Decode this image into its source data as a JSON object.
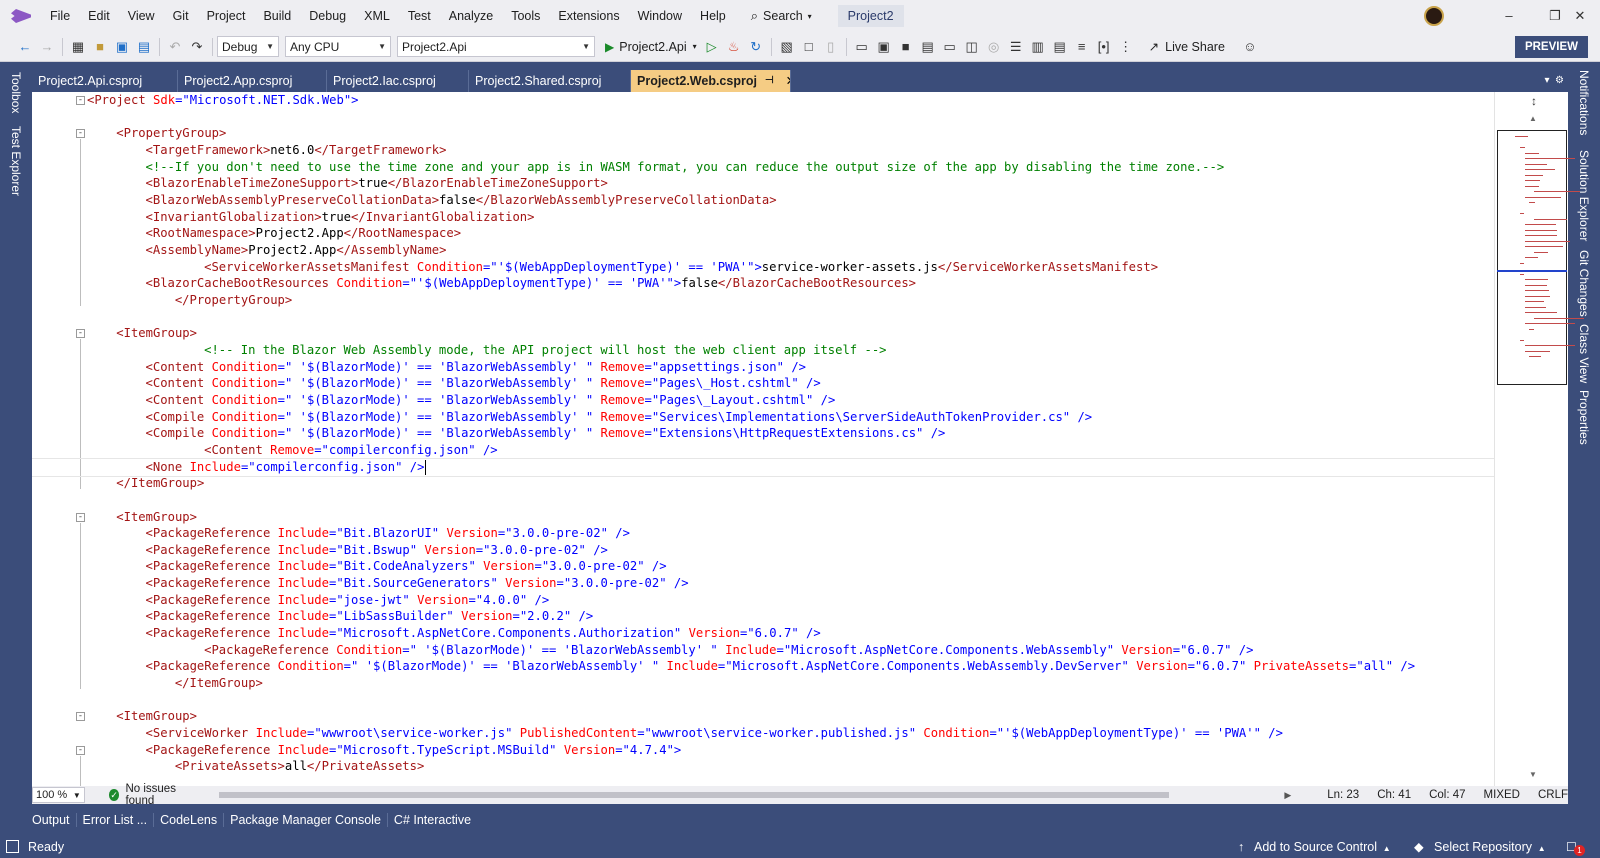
{
  "menu": {
    "items": [
      "File",
      "Edit",
      "View",
      "Git",
      "Project",
      "Build",
      "Debug",
      "XML",
      "Test",
      "Analyze",
      "Tools",
      "Extensions",
      "Window",
      "Help"
    ],
    "search_label": "Search",
    "solution_name": "Project2"
  },
  "toolbar": {
    "configuration": "Debug",
    "platform": "Any CPU",
    "startup_project": "Project2.Api",
    "run_label": "Project2.Api",
    "live_share_label": "Live Share",
    "preview_label": "PREVIEW"
  },
  "left_rail": {
    "tabs": [
      "Toolbox",
      "Test Explorer"
    ]
  },
  "right_rail": {
    "tabs": [
      "Notifications",
      "Solution Explorer",
      "Git Changes",
      "Class View",
      "Properties"
    ]
  },
  "tabs": [
    {
      "label": "Project2.Api.csproj",
      "active": false
    },
    {
      "label": "Project2.App.csproj",
      "active": false
    },
    {
      "label": "Project2.Iac.csproj",
      "active": false
    },
    {
      "label": "Project2.Shared.csproj",
      "active": false
    },
    {
      "label": "Project2.Web.csproj",
      "active": true
    }
  ],
  "editor": {
    "lines": [
      {
        "indent": 0,
        "fold": true,
        "tokens": [
          [
            "t",
            "<Project "
          ],
          [
            "a",
            "Sdk"
          ],
          [
            "p",
            "=\""
          ],
          [
            "v",
            "Microsoft.NET.Sdk.Web"
          ],
          [
            "p",
            "\">"
          ]
        ]
      },
      {
        "indent": 0,
        "tokens": []
      },
      {
        "indent": 4,
        "fold": true,
        "tokens": [
          [
            "t",
            "<PropertyGroup>"
          ]
        ]
      },
      {
        "indent": 8,
        "tokens": [
          [
            "t",
            "<TargetFramework>"
          ],
          [
            "x",
            "net6.0"
          ],
          [
            "t",
            "</TargetFramework>"
          ]
        ]
      },
      {
        "indent": 8,
        "tokens": [
          [
            "c",
            "<!--If you don't need to use the time zone and your app is in WASM format, you can reduce the output size of the app by disabling the time zone.-->"
          ]
        ]
      },
      {
        "indent": 8,
        "tokens": [
          [
            "t",
            "<BlazorEnableTimeZoneSupport>"
          ],
          [
            "x",
            "true"
          ],
          [
            "t",
            "</BlazorEnableTimeZoneSupport>"
          ]
        ]
      },
      {
        "indent": 8,
        "tokens": [
          [
            "t",
            "<BlazorWebAssemblyPreserveCollationData>"
          ],
          [
            "x",
            "false"
          ],
          [
            "t",
            "</BlazorWebAssemblyPreserveCollationData>"
          ]
        ]
      },
      {
        "indent": 8,
        "tokens": [
          [
            "t",
            "<InvariantGlobalization>"
          ],
          [
            "x",
            "true"
          ],
          [
            "t",
            "</InvariantGlobalization>"
          ]
        ]
      },
      {
        "indent": 8,
        "tokens": [
          [
            "t",
            "<RootNamespace>"
          ],
          [
            "x",
            "Project2.App"
          ],
          [
            "t",
            "</RootNamespace>"
          ]
        ]
      },
      {
        "indent": 8,
        "tokens": [
          [
            "t",
            "<AssemblyName>"
          ],
          [
            "x",
            "Project2.App"
          ],
          [
            "t",
            "</AssemblyName>"
          ]
        ]
      },
      {
        "indent": 16,
        "tokens": [
          [
            "t",
            "<ServiceWorkerAssetsManifest "
          ],
          [
            "a",
            "Condition"
          ],
          [
            "p",
            "=\"'"
          ],
          [
            "v",
            "$(WebAppDeploymentType)' == 'PWA'"
          ],
          [
            "p",
            "\">"
          ],
          [
            "x",
            "service-worker-assets.js"
          ],
          [
            "t",
            "</ServiceWorkerAssetsManifest>"
          ]
        ]
      },
      {
        "indent": 8,
        "tokens": [
          [
            "t",
            "<BlazorCacheBootResources "
          ],
          [
            "a",
            "Condition"
          ],
          [
            "p",
            "=\"'"
          ],
          [
            "v",
            "$(WebAppDeploymentType)' == 'PWA'"
          ],
          [
            "p",
            "\">"
          ],
          [
            "x",
            "false"
          ],
          [
            "t",
            "</BlazorCacheBootResources>"
          ]
        ]
      },
      {
        "indent": 12,
        "tokens": [
          [
            "t",
            "</PropertyGroup>"
          ]
        ]
      },
      {
        "indent": 0,
        "tokens": []
      },
      {
        "indent": 4,
        "fold": true,
        "tokens": [
          [
            "t",
            "<ItemGroup>"
          ]
        ]
      },
      {
        "indent": 16,
        "tokens": [
          [
            "c",
            "<!-- In the Blazor Web Assembly mode, the API project will host the web client app itself -->"
          ]
        ]
      },
      {
        "indent": 8,
        "tokens": [
          [
            "t",
            "<Content "
          ],
          [
            "a",
            "Condition"
          ],
          [
            "p",
            "=\" "
          ],
          [
            "v",
            "'$(BlazorMode)' == 'BlazorWebAssembly' "
          ],
          [
            "p",
            "\" "
          ],
          [
            "a",
            "Remove"
          ],
          [
            "p",
            "=\""
          ],
          [
            "v",
            "appsettings.json"
          ],
          [
            "p",
            "\" />"
          ]
        ]
      },
      {
        "indent": 8,
        "tokens": [
          [
            "t",
            "<Content "
          ],
          [
            "a",
            "Condition"
          ],
          [
            "p",
            "=\" "
          ],
          [
            "v",
            "'$(BlazorMode)' == 'BlazorWebAssembly' "
          ],
          [
            "p",
            "\" "
          ],
          [
            "a",
            "Remove"
          ],
          [
            "p",
            "=\""
          ],
          [
            "v",
            "Pages\\_Host.cshtml"
          ],
          [
            "p",
            "\" />"
          ]
        ]
      },
      {
        "indent": 8,
        "tokens": [
          [
            "t",
            "<Content "
          ],
          [
            "a",
            "Condition"
          ],
          [
            "p",
            "=\" "
          ],
          [
            "v",
            "'$(BlazorMode)' == 'BlazorWebAssembly' "
          ],
          [
            "p",
            "\" "
          ],
          [
            "a",
            "Remove"
          ],
          [
            "p",
            "=\""
          ],
          [
            "v",
            "Pages\\_Layout.cshtml"
          ],
          [
            "p",
            "\" />"
          ]
        ]
      },
      {
        "indent": 8,
        "tokens": [
          [
            "t",
            "<Compile "
          ],
          [
            "a",
            "Condition"
          ],
          [
            "p",
            "=\" "
          ],
          [
            "v",
            "'$(BlazorMode)' == 'BlazorWebAssembly' "
          ],
          [
            "p",
            "\" "
          ],
          [
            "a",
            "Remove"
          ],
          [
            "p",
            "=\""
          ],
          [
            "v",
            "Services\\Implementations\\ServerSideAuthTokenProvider.cs"
          ],
          [
            "p",
            "\" />"
          ]
        ]
      },
      {
        "indent": 8,
        "tokens": [
          [
            "t",
            "<Compile "
          ],
          [
            "a",
            "Condition"
          ],
          [
            "p",
            "=\" "
          ],
          [
            "v",
            "'$(BlazorMode)' == 'BlazorWebAssembly' "
          ],
          [
            "p",
            "\" "
          ],
          [
            "a",
            "Remove"
          ],
          [
            "p",
            "=\""
          ],
          [
            "v",
            "Extensions\\HttpRequestExtensions.cs"
          ],
          [
            "p",
            "\" />"
          ]
        ]
      },
      {
        "indent": 16,
        "tokens": [
          [
            "t",
            "<Content "
          ],
          [
            "a",
            "Remove"
          ],
          [
            "p",
            "=\""
          ],
          [
            "v",
            "compilerconfig.json"
          ],
          [
            "p",
            "\" />"
          ]
        ]
      },
      {
        "indent": 8,
        "current": true,
        "tokens": [
          [
            "t",
            "<None "
          ],
          [
            "a",
            "Include"
          ],
          [
            "p",
            "=\""
          ],
          [
            "v",
            "compilerconfig.json"
          ],
          [
            "p",
            "\" />"
          ]
        ]
      },
      {
        "indent": 4,
        "tokens": [
          [
            "t",
            "</ItemGroup>"
          ]
        ]
      },
      {
        "indent": 0,
        "tokens": []
      },
      {
        "indent": 4,
        "fold": true,
        "tokens": [
          [
            "t",
            "<ItemGroup>"
          ]
        ]
      },
      {
        "indent": 8,
        "tokens": [
          [
            "t",
            "<PackageReference "
          ],
          [
            "a",
            "Include"
          ],
          [
            "p",
            "=\""
          ],
          [
            "v",
            "Bit.BlazorUI"
          ],
          [
            "p",
            "\" "
          ],
          [
            "a",
            "Version"
          ],
          [
            "p",
            "=\""
          ],
          [
            "v",
            "3.0.0-pre-02"
          ],
          [
            "p",
            "\" />"
          ]
        ]
      },
      {
        "indent": 8,
        "tokens": [
          [
            "t",
            "<PackageReference "
          ],
          [
            "a",
            "Include"
          ],
          [
            "p",
            "=\""
          ],
          [
            "v",
            "Bit.Bswup"
          ],
          [
            "p",
            "\" "
          ],
          [
            "a",
            "Version"
          ],
          [
            "p",
            "=\""
          ],
          [
            "v",
            "3.0.0-pre-02"
          ],
          [
            "p",
            "\" />"
          ]
        ]
      },
      {
        "indent": 8,
        "tokens": [
          [
            "t",
            "<PackageReference "
          ],
          [
            "a",
            "Include"
          ],
          [
            "p",
            "=\""
          ],
          [
            "v",
            "Bit.CodeAnalyzers"
          ],
          [
            "p",
            "\" "
          ],
          [
            "a",
            "Version"
          ],
          [
            "p",
            "=\""
          ],
          [
            "v",
            "3.0.0-pre-02"
          ],
          [
            "p",
            "\" />"
          ]
        ]
      },
      {
        "indent": 8,
        "tokens": [
          [
            "t",
            "<PackageReference "
          ],
          [
            "a",
            "Include"
          ],
          [
            "p",
            "=\""
          ],
          [
            "v",
            "Bit.SourceGenerators"
          ],
          [
            "p",
            "\" "
          ],
          [
            "a",
            "Version"
          ],
          [
            "p",
            "=\""
          ],
          [
            "v",
            "3.0.0-pre-02"
          ],
          [
            "p",
            "\" />"
          ]
        ]
      },
      {
        "indent": 8,
        "tokens": [
          [
            "t",
            "<PackageReference "
          ],
          [
            "a",
            "Include"
          ],
          [
            "p",
            "=\""
          ],
          [
            "v",
            "jose-jwt"
          ],
          [
            "p",
            "\" "
          ],
          [
            "a",
            "Version"
          ],
          [
            "p",
            "=\""
          ],
          [
            "v",
            "4.0.0"
          ],
          [
            "p",
            "\" />"
          ]
        ]
      },
      {
        "indent": 8,
        "tokens": [
          [
            "t",
            "<PackageReference "
          ],
          [
            "a",
            "Include"
          ],
          [
            "p",
            "=\""
          ],
          [
            "v",
            "LibSassBuilder"
          ],
          [
            "p",
            "\" "
          ],
          [
            "a",
            "Version"
          ],
          [
            "p",
            "=\""
          ],
          [
            "v",
            "2.0.2"
          ],
          [
            "p",
            "\" />"
          ]
        ]
      },
      {
        "indent": 8,
        "tokens": [
          [
            "t",
            "<PackageReference "
          ],
          [
            "a",
            "Include"
          ],
          [
            "p",
            "=\""
          ],
          [
            "v",
            "Microsoft.AspNetCore.Components.Authorization"
          ],
          [
            "p",
            "\" "
          ],
          [
            "a",
            "Version"
          ],
          [
            "p",
            "=\""
          ],
          [
            "v",
            "6.0.7"
          ],
          [
            "p",
            "\" />"
          ]
        ]
      },
      {
        "indent": 16,
        "tokens": [
          [
            "t",
            "<PackageReference "
          ],
          [
            "a",
            "Condition"
          ],
          [
            "p",
            "=\" "
          ],
          [
            "v",
            "'$(BlazorMode)' == 'BlazorWebAssembly' "
          ],
          [
            "p",
            "\" "
          ],
          [
            "a",
            "Include"
          ],
          [
            "p",
            "=\""
          ],
          [
            "v",
            "Microsoft.AspNetCore.Components.WebAssembly"
          ],
          [
            "p",
            "\" "
          ],
          [
            "a",
            "Version"
          ],
          [
            "p",
            "=\""
          ],
          [
            "v",
            "6.0.7"
          ],
          [
            "p",
            "\" />"
          ]
        ]
      },
      {
        "indent": 8,
        "tokens": [
          [
            "t",
            "<PackageReference "
          ],
          [
            "a",
            "Condition"
          ],
          [
            "p",
            "=\" "
          ],
          [
            "v",
            "'$(BlazorMode)' == 'BlazorWebAssembly' "
          ],
          [
            "p",
            "\" "
          ],
          [
            "a",
            "Include"
          ],
          [
            "p",
            "=\""
          ],
          [
            "v",
            "Microsoft.AspNetCore.Components.WebAssembly.DevServer"
          ],
          [
            "p",
            "\" "
          ],
          [
            "a",
            "Version"
          ],
          [
            "p",
            "=\""
          ],
          [
            "v",
            "6.0.7"
          ],
          [
            "p",
            "\" "
          ],
          [
            "a",
            "PrivateAssets"
          ],
          [
            "p",
            "=\""
          ],
          [
            "v",
            "all"
          ],
          [
            "p",
            "\" />"
          ]
        ]
      },
      {
        "indent": 12,
        "tokens": [
          [
            "t",
            "</ItemGroup>"
          ]
        ]
      },
      {
        "indent": 0,
        "tokens": []
      },
      {
        "indent": 4,
        "fold": true,
        "tokens": [
          [
            "t",
            "<ItemGroup>"
          ]
        ]
      },
      {
        "indent": 8,
        "tokens": [
          [
            "t",
            "<ServiceWorker "
          ],
          [
            "a",
            "Include"
          ],
          [
            "p",
            "=\""
          ],
          [
            "v",
            "wwwroot\\service-worker.js"
          ],
          [
            "p",
            "\" "
          ],
          [
            "a",
            "PublishedContent"
          ],
          [
            "p",
            "=\""
          ],
          [
            "v",
            "wwwroot\\service-worker.published.js"
          ],
          [
            "p",
            "\" "
          ],
          [
            "a",
            "Condition"
          ],
          [
            "p",
            "=\"'"
          ],
          [
            "v",
            "$(WebAppDeploymentType)' == 'PWA'"
          ],
          [
            "p",
            "\" />"
          ]
        ]
      },
      {
        "indent": 8,
        "fold": true,
        "tokens": [
          [
            "t",
            "<PackageReference "
          ],
          [
            "a",
            "Include"
          ],
          [
            "p",
            "=\""
          ],
          [
            "v",
            "Microsoft.TypeScript.MSBuild"
          ],
          [
            "p",
            "\" "
          ],
          [
            "a",
            "Version"
          ],
          [
            "p",
            "=\""
          ],
          [
            "v",
            "4.7.4"
          ],
          [
            "p",
            "\">"
          ]
        ]
      },
      {
        "indent": 12,
        "tokens": [
          [
            "t",
            "<PrivateAssets>"
          ],
          [
            "x",
            "all"
          ],
          [
            "t",
            "</PrivateAssets>"
          ]
        ]
      }
    ]
  },
  "status": {
    "zoom": "100 %",
    "issues": "No issues found",
    "line": "Ln: 23",
    "char": "Ch: 41",
    "col": "Col: 47",
    "mixed": "MIXED",
    "eol": "CRLF"
  },
  "tool_tabs": [
    "Output",
    "Error List ...",
    "CodeLens",
    "Package Manager Console",
    "C# Interactive"
  ],
  "statusbar": {
    "ready": "Ready",
    "source_control": "Add to Source Control",
    "select_repo": "Select Repository",
    "notification_count": "1"
  }
}
